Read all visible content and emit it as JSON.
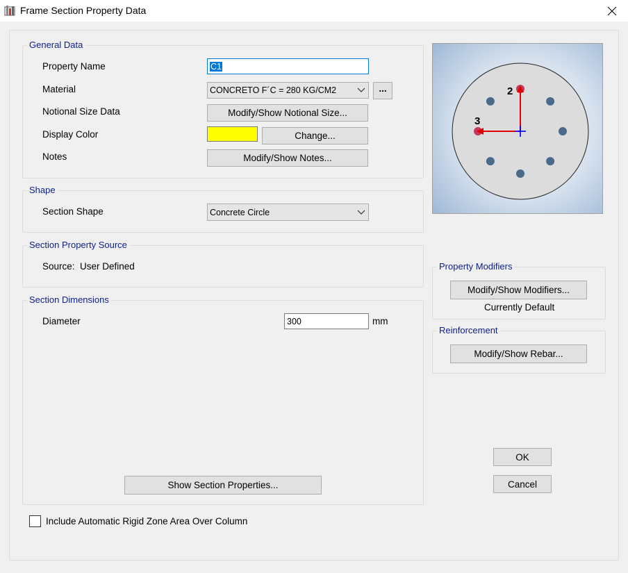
{
  "window": {
    "title": "Frame Section Property Data"
  },
  "general": {
    "legend": "General Data",
    "property_name_label": "Property Name",
    "property_name_value": "C1",
    "material_label": "Material",
    "material_value": "CONCRETO F´C = 280 KG/CM2",
    "material_browse": "...",
    "notional_label": "Notional Size Data",
    "notional_button": "Modify/Show Notional Size...",
    "color_label": "Display Color",
    "color_value": "#ffff00",
    "color_button": "Change...",
    "notes_label": "Notes",
    "notes_button": "Modify/Show Notes..."
  },
  "shape": {
    "legend": "Shape",
    "section_shape_label": "Section Shape",
    "section_shape_value": "Concrete Circle"
  },
  "source": {
    "legend": "Section Property Source",
    "text": "Source:  User Defined"
  },
  "dimensions": {
    "legend": "Section Dimensions",
    "diameter_label": "Diameter",
    "diameter_value": "300",
    "diameter_unit": "mm",
    "show_props_button": "Show Section Properties..."
  },
  "preview": {
    "axis2_label": "2",
    "axis3_label": "3",
    "rebar_count": 8
  },
  "modifiers": {
    "legend": "Property Modifiers",
    "button": "Modify/Show Modifiers...",
    "status": "Currently Default"
  },
  "reinforcement": {
    "legend": "Reinforcement",
    "button": "Modify/Show Rebar..."
  },
  "rigid_zone": {
    "label": "Include Automatic Rigid Zone Area Over Column",
    "checked": false
  },
  "actions": {
    "ok": "OK",
    "cancel": "Cancel"
  },
  "colors": {
    "legend_text": "#0b1e8c",
    "accent": "#0078d7",
    "axis": "#e00000",
    "centroid": "#0000ff",
    "rebar": "#4a6a8c"
  }
}
